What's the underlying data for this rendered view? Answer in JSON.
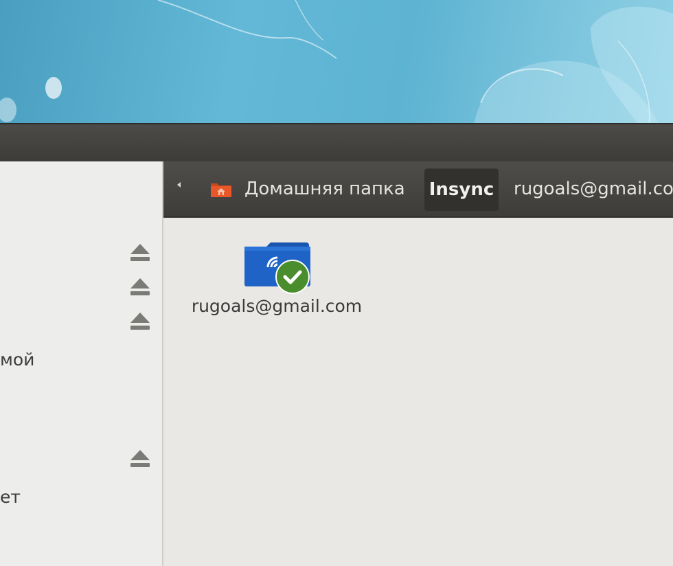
{
  "sidebar": {
    "items": [
      {
        "label": "",
        "ejectable": true
      },
      {
        "label": "",
        "ejectable": true
      },
      {
        "label": "",
        "ejectable": true
      },
      {
        "label": "мой",
        "ejectable": false
      },
      {
        "label": "",
        "ejectable": true
      },
      {
        "label": "ет",
        "ejectable": false
      }
    ]
  },
  "toolbar": {
    "breadcrumbs": [
      {
        "label": "Домашняя папка",
        "icon": "home-folder-icon"
      },
      {
        "label": "Insync",
        "active": true
      },
      {
        "label": "rugoals@gmail.co"
      }
    ]
  },
  "content": {
    "items": [
      {
        "name": "rugoals@gmail.com",
        "icon": "insync-synced-folder-icon"
      }
    ]
  },
  "colors": {
    "toolbar": "#45433f",
    "sidebar": "#ededeb",
    "content": "#e9e8e4",
    "folder": "#1f63c6",
    "sync_badge": "#4a8d2c"
  }
}
